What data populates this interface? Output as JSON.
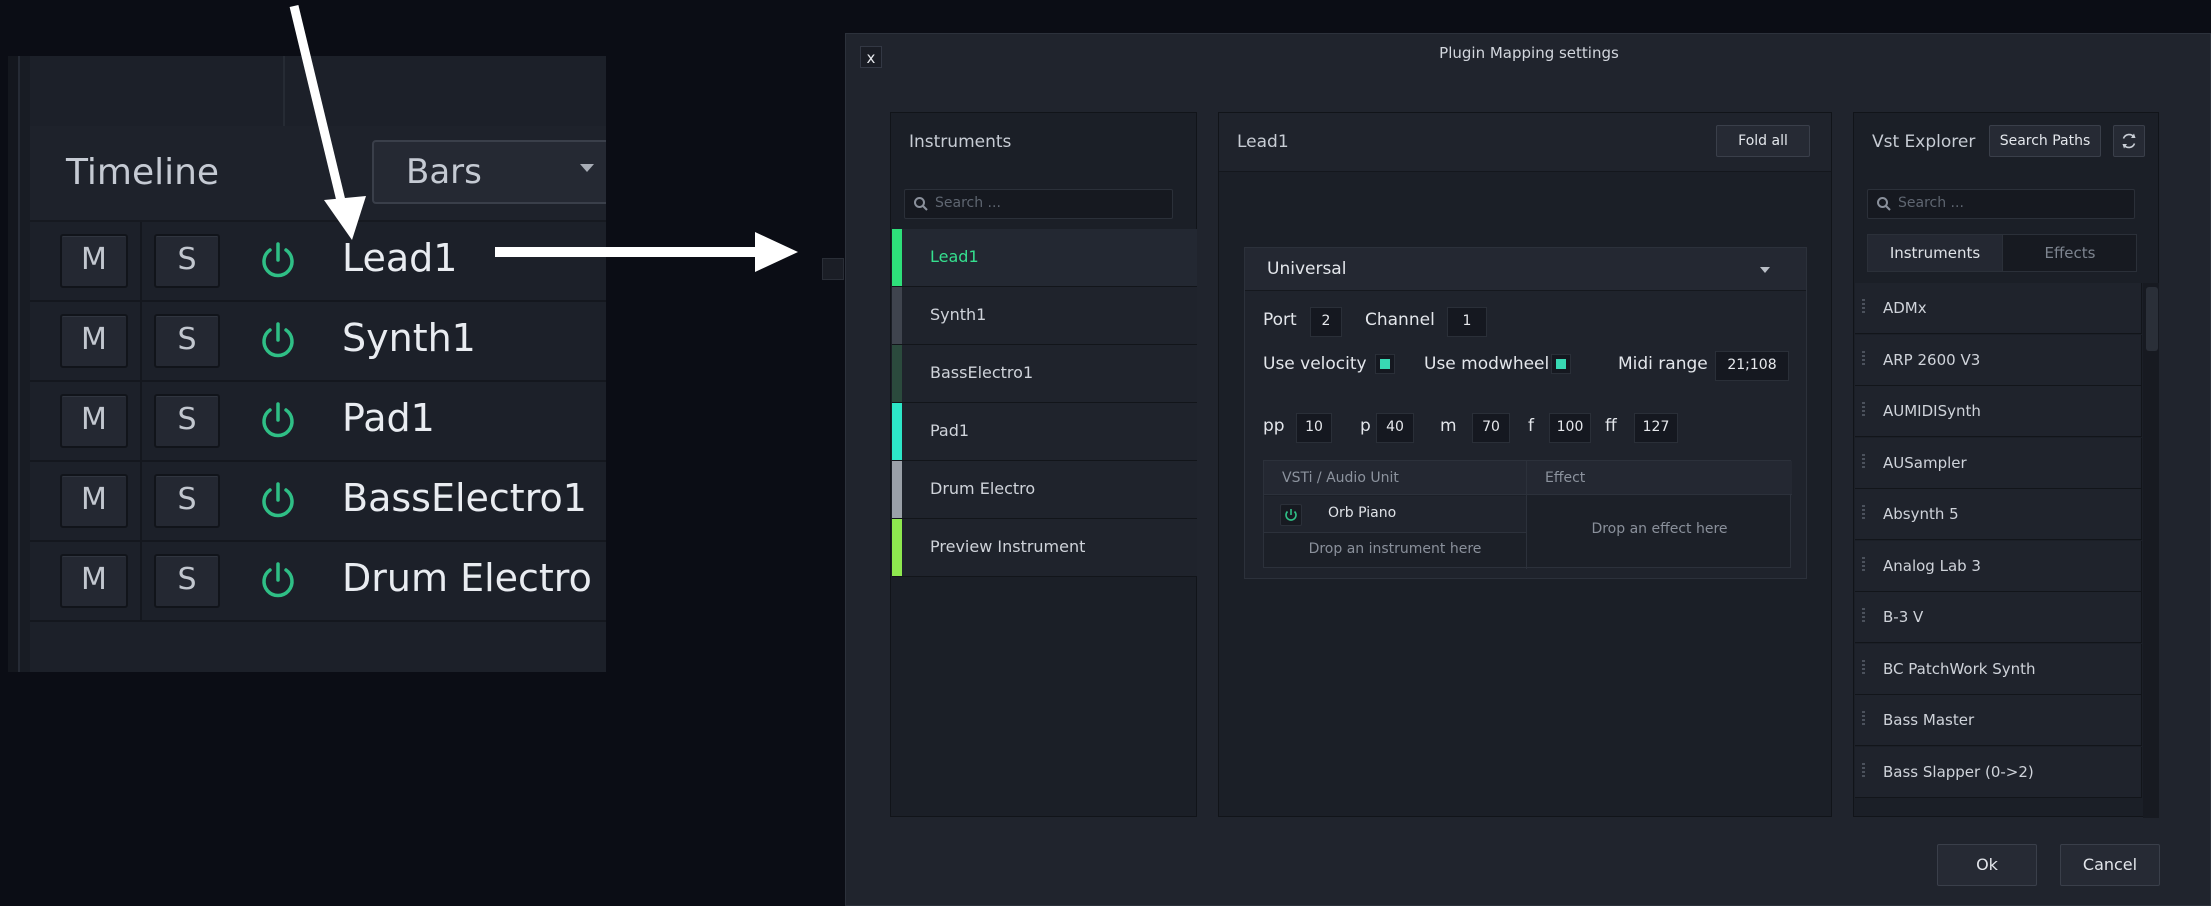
{
  "timeline": {
    "title": "Timeline",
    "view_select": "Bars",
    "tracks": [
      {
        "mute": "M",
        "solo": "S",
        "name": "Lead1"
      },
      {
        "mute": "M",
        "solo": "S",
        "name": "Synth1"
      },
      {
        "mute": "M",
        "solo": "S",
        "name": "Pad1"
      },
      {
        "mute": "M",
        "solo": "S",
        "name": "BassElectro1"
      },
      {
        "mute": "M",
        "solo": "S",
        "name": "Drum Electro"
      }
    ]
  },
  "dialog": {
    "title": "Plugin Mapping settings",
    "close_label": "x",
    "instruments": {
      "title": "Instruments",
      "search_placeholder": "Search ...",
      "items": [
        {
          "label": "Lead1",
          "color": "#2ee07a",
          "selected": true
        },
        {
          "label": "Synth1",
          "color": "#3f444e"
        },
        {
          "label": "BassElectro1",
          "color": "#2b4a3d"
        },
        {
          "label": "Pad1",
          "color": "#2de6c8"
        },
        {
          "label": "Drum Electro",
          "color": "#9aa0a8"
        },
        {
          "label": "Preview Instrument",
          "color": "#8ee84f"
        }
      ]
    },
    "mapping": {
      "title": "Lead1",
      "fold_all": "Fold all",
      "section": "Universal",
      "port_label": "Port",
      "port": "2",
      "channel_label": "Channel",
      "channel": "1",
      "use_velocity_label": "Use velocity",
      "use_modwheel_label": "Use modwheel",
      "midi_range_label": "Midi range",
      "midi_range": "21;108",
      "dynamics": [
        {
          "label": "pp",
          "value": "10"
        },
        {
          "label": "p",
          "value": "40"
        },
        {
          "label": "m",
          "value": "70"
        },
        {
          "label": "f",
          "value": "100"
        },
        {
          "label": "ff",
          "value": "127"
        }
      ],
      "col_vsti": "VSTi / Audio Unit",
      "col_effect": "Effect",
      "instrument_plugin": "Orb Piano",
      "drop_instrument": "Drop an instrument here",
      "drop_effect": "Drop an effect here"
    },
    "vst": {
      "title": "Vst Explorer",
      "search_paths": "Search Paths",
      "search_placeholder": "Search ...",
      "tab_instruments": "Instruments",
      "tab_effects": "Effects",
      "items": [
        "ADMx",
        "ARP 2600 V3",
        "AUMIDISynth",
        "AUSampler",
        "Absynth 5",
        "Analog Lab 3",
        "B-3 V",
        "BC PatchWork Synth",
        "Bass Master",
        "Bass Slapper (0->2)"
      ]
    },
    "ok": "Ok",
    "cancel": "Cancel"
  },
  "colors": {
    "accent": "#35e08f",
    "power": "#2fbf86",
    "checkbox": "#38d9b4",
    "arrow": "#ffffff"
  }
}
